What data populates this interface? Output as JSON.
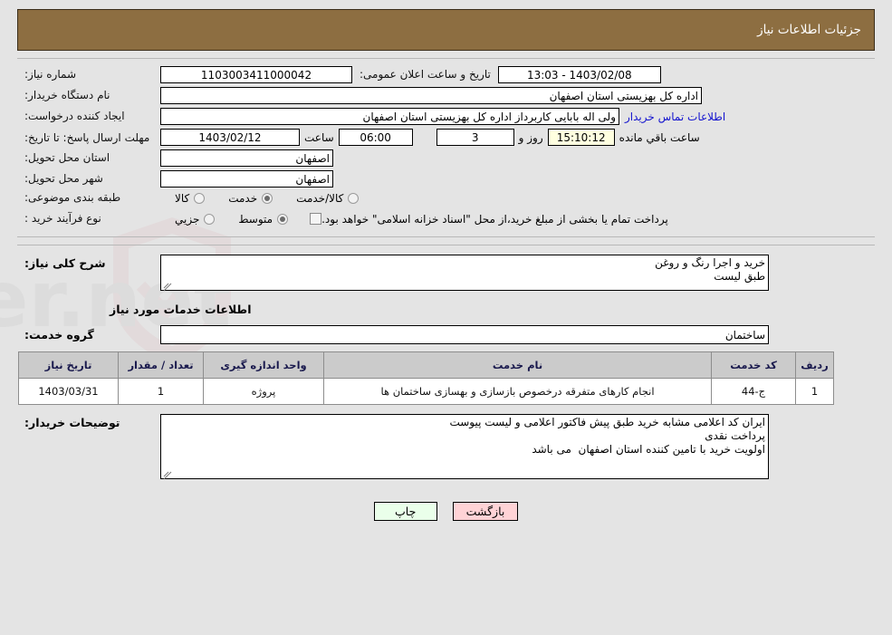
{
  "header": {
    "title": "جزئیات اطلاعات نیاز"
  },
  "form": {
    "need_number_label": "شماره نیاز:",
    "need_number_value": "1103003411000042",
    "announce_datetime_label": "تاریخ و ساعت اعلان عمومی:",
    "announce_datetime_value": "1403/02/08 - 13:03",
    "buyer_org_label": "نام دستگاه خریدار:",
    "buyer_org_value": "اداره کل بهزیستی استان اصفهان",
    "requester_label": "ایجاد کننده درخواست:",
    "requester_value": "ولی اله بابایی کاربرداز اداره کل بهزیستی استان اصفهان",
    "contact_link": "اطلاعات تماس خریدار",
    "deadline_label": "مهلت ارسال پاسخ: تا تاریخ:",
    "deadline_date": "1403/02/12",
    "hour_label": "ساعت",
    "hour_value": "06:00",
    "days_value": "3",
    "days_label": "روز و",
    "countdown_value": "15:10:12",
    "countdown_label": "ساعت باقي مانده",
    "province_label": "استان محل تحویل:",
    "province_value": "اصفهان",
    "city_label": "شهر محل تحویل:",
    "city_value": "اصفهان",
    "category_label": "طبقه بندی موضوعی:",
    "category_options": [
      {
        "label": "کالا",
        "selected": false
      },
      {
        "label": "خدمت",
        "selected": true
      },
      {
        "label": "کالا/خدمت",
        "selected": false
      }
    ],
    "process_label": "نوع فرآیند خرید :",
    "process_options": [
      {
        "label": "جزيي",
        "selected": false
      },
      {
        "label": "متوسط",
        "selected": true
      }
    ],
    "treasury_checkbox_text": "پرداخت تمام یا بخشی از مبلغ خرید،از محل \"اسناد خزانه اسلامی\" خواهد بود.",
    "treasury_checked": false
  },
  "description": {
    "label": "شرح کلی نیاز:",
    "value": "خرید و اجرا رنگ و روغن\nطبق لیست"
  },
  "services_section": {
    "heading": "اطلاعات خدمات مورد نیاز",
    "group_label": "گروه خدمت:",
    "group_value": "ساختمان"
  },
  "table": {
    "columns": [
      "ردیف",
      "کد خدمت",
      "نام خدمت",
      "واحد اندازه گیری",
      "تعداد / مقدار",
      "تاریخ نیاز"
    ],
    "rows": [
      {
        "radif": "1",
        "code": "ج-44",
        "name": "انجام کارهای متفرقه درخصوص بازسازی و بهسازی ساختمان ها",
        "unit": "پروژه",
        "qty": "1",
        "date": "1403/03/31"
      }
    ]
  },
  "buyer_notes": {
    "label": "توضیحات خریدار:",
    "value": "ایران کد اعلامی مشابه خرید طبق پیش فاکتور اعلامی و لیست پیوست\nپرداخت نقدی\nاولویت خرید با تامین کننده استان اصفهان  می باشد"
  },
  "buttons": {
    "print": "چاپ",
    "back": "بازگشت"
  },
  "colors": {
    "header_brown": "#8d6e41",
    "page_bg": "#e4e4e4",
    "link_blue": "#1414cf",
    "table_header_bg": "#cbcbcb",
    "countdown_bg": "#ffffe0",
    "print_btn_bg": "#eaffea",
    "back_btn_bg": "#ffd3d6"
  }
}
